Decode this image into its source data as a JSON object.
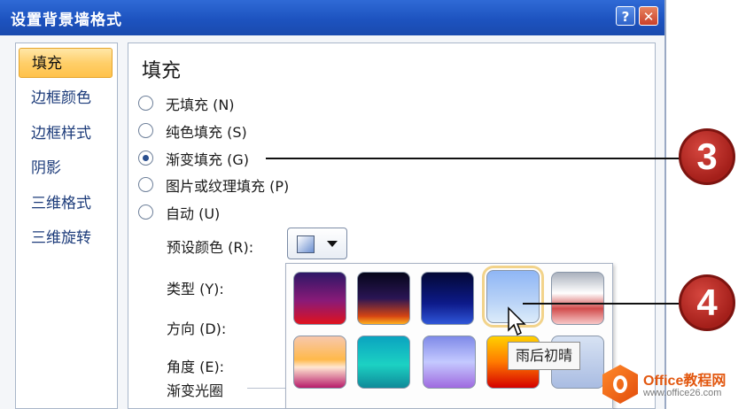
{
  "window": {
    "title": "设置背景墙格式",
    "help_label": "?",
    "close_label": "✕"
  },
  "sidebar": {
    "items": [
      {
        "label": "填充",
        "active": true
      },
      {
        "label": "边框颜色"
      },
      {
        "label": "边框样式"
      },
      {
        "label": "阴影"
      },
      {
        "label": "三维格式"
      },
      {
        "label": "三维旋转"
      }
    ]
  },
  "fill": {
    "heading": "填充",
    "options": [
      {
        "label": "无填充 (N)",
        "selected": false
      },
      {
        "label": "纯色填充 (S)",
        "selected": false
      },
      {
        "label": "渐变填充 (G)",
        "selected": true
      },
      {
        "label": "图片或纹理填充 (P)",
        "selected": false
      },
      {
        "label": "自动 (U)",
        "selected": false
      }
    ],
    "preset_colors_label": "预设颜色 (R):",
    "type_label": "类型 (Y):",
    "direction_label": "方向 (D):",
    "angle_label": "角度 (E):",
    "gradient_stops_label": "渐变光圈"
  },
  "gallery": {
    "tooltip": "雨后初晴",
    "selected_index": 3,
    "swatch_icons": [
      "gradient-swatch-purple-red",
      "gradient-swatch-dark-orange",
      "gradient-swatch-dark-blue",
      "gradient-swatch-sky-blue",
      "gradient-swatch-silver-red",
      "gradient-swatch-peach",
      "gradient-swatch-teal",
      "gradient-swatch-lavender",
      "gradient-swatch-fire",
      "gradient-swatch-pale-blue"
    ]
  },
  "callouts": {
    "step_3": "3",
    "step_4": "4"
  },
  "watermark": {
    "name": "Office教程网",
    "url": "www.office26.com"
  },
  "colors": {
    "titlebar": "#1d53c0",
    "active_nav": "#ffcf6a",
    "callout": "#b8261f"
  }
}
